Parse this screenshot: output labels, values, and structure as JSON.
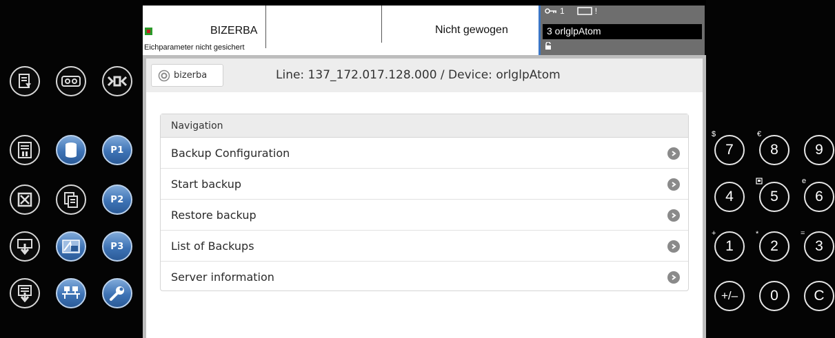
{
  "header": {
    "brand": "BIZERBA",
    "calibration_message": "Eichparameter nicht gesichert",
    "weigh_status": "Nicht gewogen"
  },
  "status": {
    "key_level": "1",
    "alert": "!",
    "device_line": "3 orlglpAtom"
  },
  "browser": {
    "logo_text": "bizerba",
    "line_info": "Line: 137_172.017.128.000 / Device: orlglpAtom"
  },
  "navigation": {
    "header": "Navigation",
    "items": [
      {
        "label": "Backup Configuration"
      },
      {
        "label": "Start backup"
      },
      {
        "label": "Restore backup"
      },
      {
        "label": "List of Backups"
      },
      {
        "label": "Server information"
      }
    ]
  },
  "softkeys": {
    "p1": "P1",
    "p2": "P2",
    "p3": "P3",
    "icons": [
      "document-icon",
      "cassette-icon",
      "barcode-icon",
      "list-pause-icon",
      "database-icon",
      "p1-key",
      "cancel-box-icon",
      "copy-file-icon",
      "p2-key",
      "download-icon",
      "scale-display-icon",
      "p3-key",
      "list-download-icon",
      "network-icon",
      "wrench-icon"
    ]
  },
  "keypad": {
    "k7": "7",
    "k8": "8",
    "k9": "9",
    "k4": "4",
    "k5": "5",
    "k6": "6",
    "k1": "1",
    "k2": "2",
    "k3": "3",
    "kpm": "+/–",
    "k0": "0",
    "kc": "C",
    "s_dollar": "$",
    "s_euro": "€",
    "s_e": "e",
    "s_plus": "+",
    "s_star": "*",
    "s_eq": "="
  },
  "colors": {
    "accent_blue": "#3e73b5",
    "status_bar": "#6e6e6e",
    "nav_header": "#ececec"
  }
}
